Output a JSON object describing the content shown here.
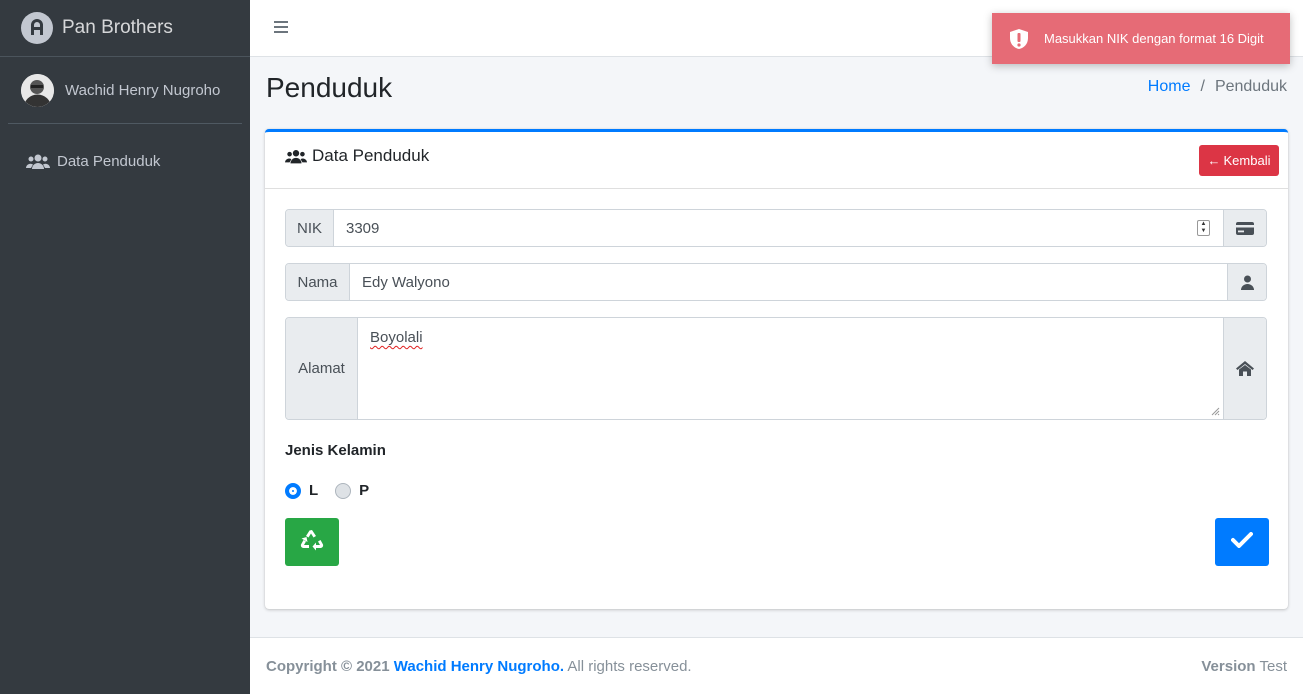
{
  "sidebar": {
    "brand": "Pan Brothers",
    "user_name": "Wachid Henry Nugroho",
    "items": [
      {
        "label": "Data Penduduk",
        "icon": "users-icon"
      }
    ]
  },
  "toast": {
    "message": "Masukkan NIK dengan format 16 Digit",
    "icon": "exclamation-shield-icon",
    "color": "#e66b76"
  },
  "header": {
    "title": "Penduduk",
    "breadcrumb": [
      "Home",
      "Penduduk"
    ]
  },
  "card": {
    "title": "Data Penduduk",
    "back_button": "Kembali",
    "fields": {
      "nik": {
        "label": "NIK",
        "value": "3309",
        "icon": "id-card-icon"
      },
      "nama": {
        "label": "Nama",
        "value": "Edy Walyono",
        "icon": "user-icon"
      },
      "alamat": {
        "label": "Alamat",
        "value": "Boyolali",
        "icon": "home-icon"
      }
    },
    "gender": {
      "label": "Jenis Kelamin",
      "options": [
        "L",
        "P"
      ],
      "selected": "L"
    }
  },
  "footer": {
    "copyright_prefix": "Copyright © 2021",
    "author": "Wachid Henry Nugroho.",
    "suffix": "All rights reserved.",
    "version_label": "Version",
    "version_value": "Test"
  },
  "colors": {
    "primary": "#007bff",
    "danger": "#dc3545",
    "success": "#28a745",
    "sidebar": "#343a40"
  }
}
